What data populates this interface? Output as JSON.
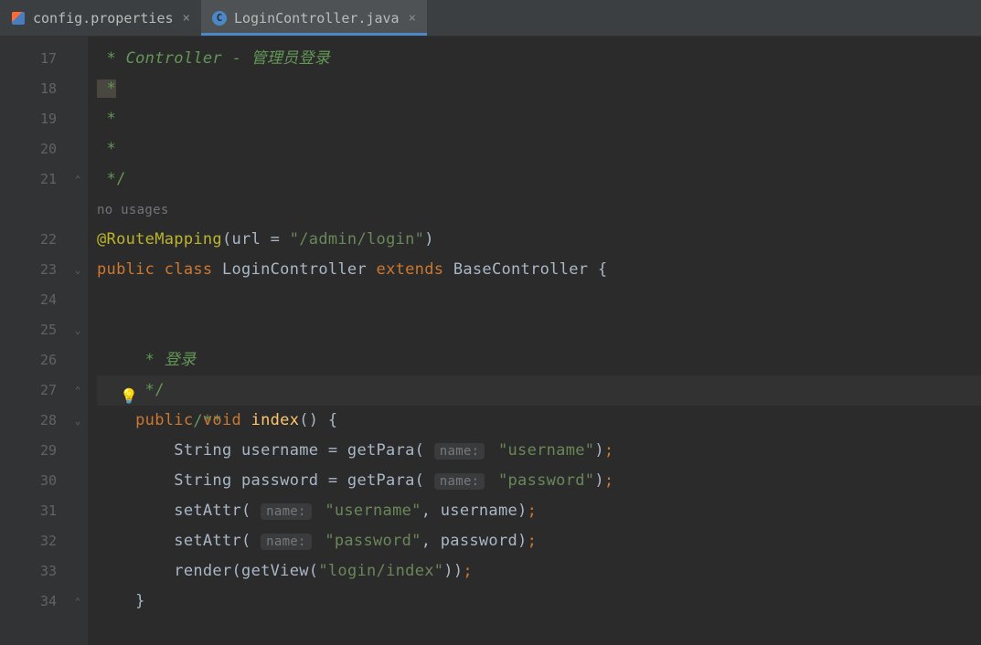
{
  "tabs": [
    {
      "name": "config.properties",
      "active": false
    },
    {
      "name": "LoginController.java",
      "active": true
    }
  ],
  "lineNumbers": [
    "17",
    "18",
    "19",
    "20",
    "21",
    "",
    "22",
    "23",
    "24",
    "25",
    "26",
    "27",
    "28",
    "29",
    "30",
    "31",
    "32",
    "33",
    "34"
  ],
  "code": {
    "l17a": " * ",
    "l17b": "Controller",
    "l17sep": " - ",
    "l17c": "管理员登录",
    "l18": " *",
    "l19": " *",
    "l20": " *",
    "l21": " */",
    "nousages": "no usages",
    "l22_ann": "@RouteMapping",
    "l22_p1": "(",
    "l22_url": "url ",
    "l22_eq": "= ",
    "l22_str": "\"/admin/login\"",
    "l22_p2": ")",
    "l23_pub": "public ",
    "l23_cls": "class ",
    "l23_name": "LoginController ",
    "l23_ext": "extends ",
    "l23_base": "BaseController {",
    "l25_doc": "/**",
    "l26a": " * ",
    "l26b": "登录",
    "l27": " */",
    "l28_pub": "public ",
    "l28_void": "void ",
    "l28_m": "index",
    "l28_p": "() {",
    "l29_s": "String username = ",
    "l29_m": "getPara",
    "l29_p1": "(",
    "l29_hint": "name:",
    "l29_str": "\"username\"",
    "l29_p2": ")",
    "l29_semi": ";",
    "l30_s": "String password = ",
    "l30_m": "getPara",
    "l30_p1": "(",
    "l30_hint": "name:",
    "l30_str": "\"password\"",
    "l30_p2": ")",
    "l30_semi": ";",
    "l31_m": "setAttr",
    "l31_p1": "(",
    "l31_hint": "name:",
    "l31_str": "\"username\"",
    "l31_c": ", username)",
    "l31_semi": ";",
    "l32_m": "setAttr",
    "l32_p1": "(",
    "l32_hint": "name:",
    "l32_str": "\"password\"",
    "l32_c": ", password)",
    "l32_semi": ";",
    "l33_m": "render",
    "l33_p1": "(",
    "l33_m2": "getView",
    "l33_p2": "(",
    "l33_str": "\"login/index\"",
    "l33_p3": "))",
    "l33_semi": ";",
    "l34": "}"
  }
}
